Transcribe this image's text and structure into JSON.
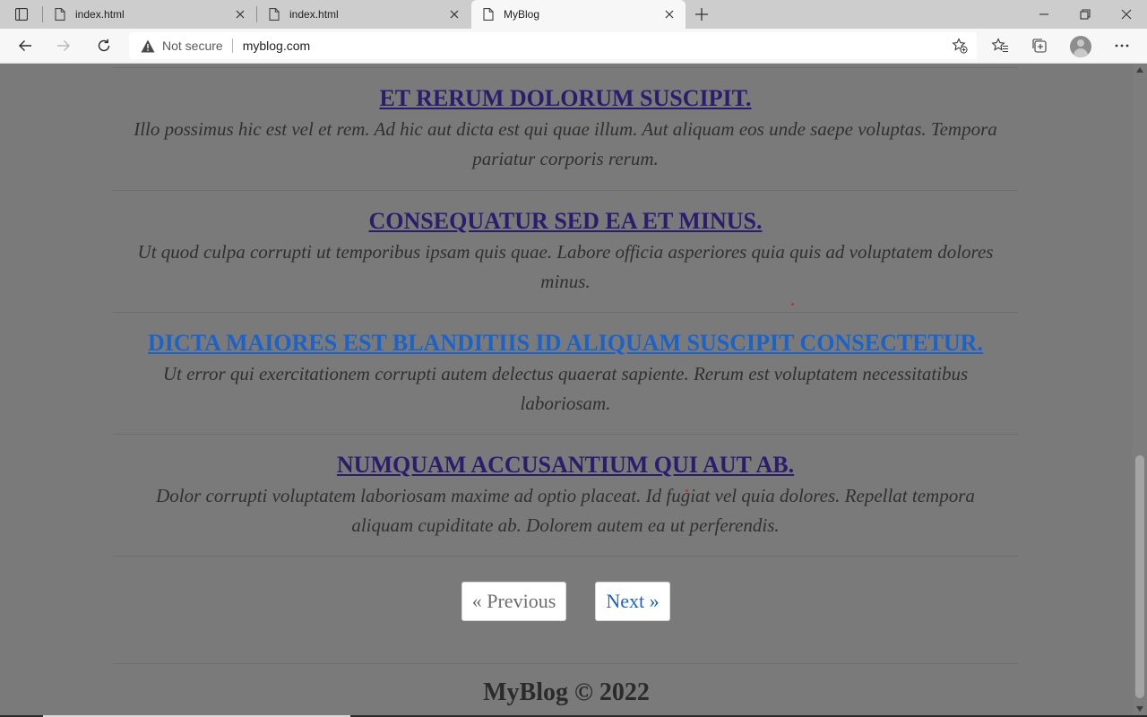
{
  "browser": {
    "tabs": [
      {
        "title": "index.html",
        "active": false
      },
      {
        "title": "index.html",
        "active": false
      },
      {
        "title": "MyBlog",
        "active": true
      }
    ],
    "security_label": "Not secure",
    "url": "myblog.com"
  },
  "posts": [
    {
      "title": "ET RERUM DOLORUM SUSCIPIT.",
      "excerpt_line1": "Illo possimus hic est vel et rem. Ad hic aut dicta est qui quae illum. Aut aliquam eos unde saepe voluptas. Tempora",
      "excerpt_line2": "pariatur corporis rerum."
    },
    {
      "title": "CONSEQUATUR SED EA ET MINUS.",
      "excerpt_line1": "Ut quod culpa corrupti ut temporibus ipsam quis quae. Labore officia asperiores quia quis ad voluptatem dolores",
      "excerpt_line2": "minus."
    },
    {
      "title": "DICTA MAIORES EST BLANDITIIS ID ALIQUAM SUSCIPIT CONSECTETUR.",
      "excerpt_line1": "Ut error qui exercitationem corrupti autem delectus quaerat sapiente. Rerum est voluptatem necessitatibus",
      "excerpt_line2": "laboriosam."
    },
    {
      "title": "NUMQUAM ACCUSANTIUM QUI AUT AB.",
      "excerpt_line1": "Dolor corrupti voluptatem laboriosam maxime ad optio placeat. Id fugiat vel quia dolores. Repellat tempora",
      "excerpt_line2": "aliquam cupiditate ab. Dolorem autem ea ut perferendis."
    }
  ],
  "pagination": {
    "previous_label": "« Previous",
    "next_label": "Next »"
  },
  "footer": {
    "text": "MyBlog © 2022"
  },
  "colors": {
    "overlay_background": "#7a7a7a",
    "link": "#2b1c6e",
    "link_hover": "#1b63c9"
  }
}
